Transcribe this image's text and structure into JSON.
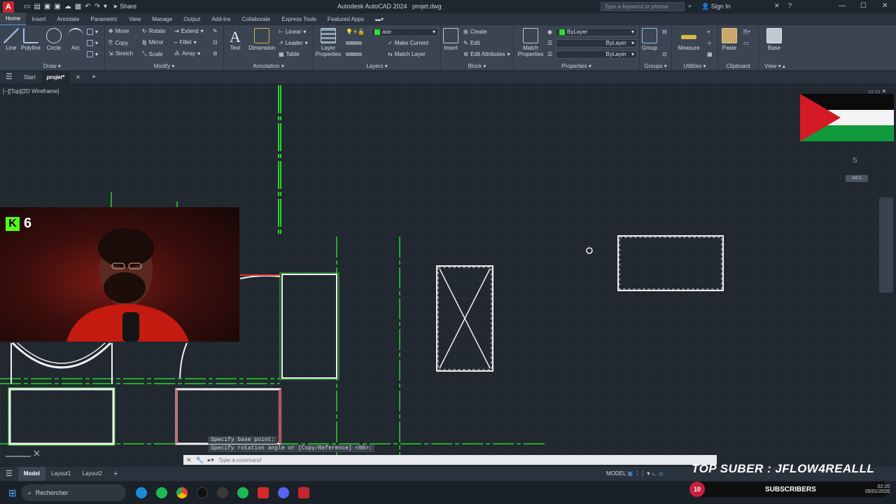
{
  "titlebar": {
    "logo": "A",
    "share_label": "Share",
    "title": "Autodesk AutoCAD 2024",
    "filename": "projet.dwg",
    "search_placeholder": "Type a keyword or phrase",
    "signin_label": "Sign In",
    "minimize": "—",
    "maximize": "☐",
    "close": "✕"
  },
  "ribbon_tabs": [
    "Home",
    "Insert",
    "Annotate",
    "Parametric",
    "View",
    "Manage",
    "Output",
    "Add-ins",
    "Collaborate",
    "Express Tools",
    "Featured Apps"
  ],
  "ribbon": {
    "draw": {
      "title": "Draw",
      "line": "Line",
      "polyline": "Polyline",
      "circle": "Circle",
      "arc": "Arc"
    },
    "modify": {
      "title": "Modify",
      "move": "Move",
      "rotate": "Rotate",
      "extend": "Extend",
      "copy": "Copy",
      "mirror": "Mirror",
      "fillet": "Fillet",
      "stretch": "Stretch",
      "scale": "Scale",
      "array": "Array"
    },
    "annotation": {
      "title": "Annotation",
      "text": "Text",
      "dimension": "Dimension",
      "linear": "Linear",
      "leader": "Leader",
      "table": "Table"
    },
    "layers": {
      "title": "Layers",
      "layer_properties_1": "Layer",
      "layer_properties_2": "Properties",
      "current_layer": "axe",
      "make_current": "Make Current",
      "match_layer": "Match Layer"
    },
    "block": {
      "title": "Block",
      "insert": "Insert",
      "create": "Create",
      "edit": "Edit",
      "edit_attributes": "Edit Attributes"
    },
    "properties": {
      "title": "Properties",
      "match_1": "Match",
      "match_2": "Properties",
      "color": "ByLayer",
      "linetype": "ByLayer",
      "lineweight": "ByLayer"
    },
    "groups": {
      "title": "Groups",
      "group": "Group"
    },
    "utilities": {
      "title": "Utilities",
      "measure": "Measure"
    },
    "clipboard": {
      "title": "Clipboard",
      "paste": "Paste"
    },
    "view": {
      "title": "View",
      "base": "Base"
    }
  },
  "file_tabs": {
    "start": "Start",
    "current": "projet*"
  },
  "viewport": {
    "label": "[−][Top][2D Wireframe]",
    "compass": "S",
    "wcs": "WCS"
  },
  "overlay": {
    "kick_count": "6",
    "top_suber": "TOP SUBER : JFLOW4REALLL",
    "subs_count": "10",
    "subs_label": "SUBSCRIBERS"
  },
  "command": {
    "history_1": "Specify base point:",
    "history_2": "Specify rotation angle or [Copy/Reference] <90>:",
    "placeholder": "Type a command"
  },
  "layout_tabs": [
    "Model",
    "Layout1",
    "Layout2"
  ],
  "status": {
    "model": "MODEL"
  },
  "taskbar": {
    "search": "Rechercher",
    "time": "02:20",
    "date": "05/01/2026"
  }
}
